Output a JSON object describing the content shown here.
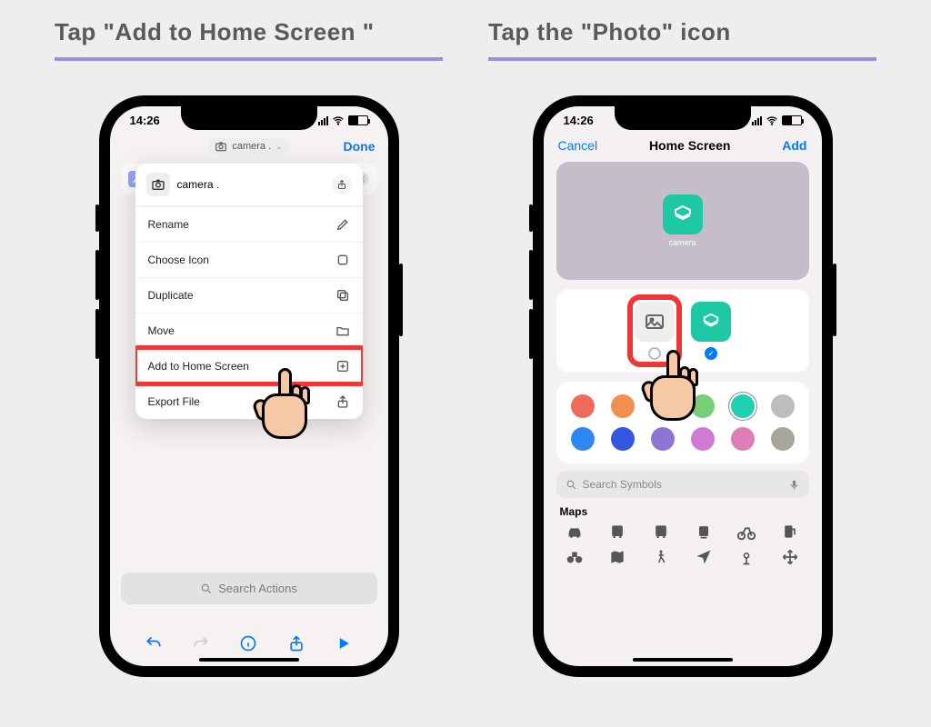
{
  "headings": {
    "left": "Tap \"Add to Home Screen \"",
    "right": "Tap the \"Photo\" icon"
  },
  "status": {
    "time": "14:26"
  },
  "left": {
    "title_pill": "camera .",
    "done": "Done",
    "menu_title": "camera .",
    "menu_items": [
      {
        "label": "Rename"
      },
      {
        "label": "Choose Icon"
      },
      {
        "label": "Duplicate"
      },
      {
        "label": "Move"
      },
      {
        "label": "Add to Home Screen"
      },
      {
        "label": "Export File"
      }
    ],
    "search_placeholder": "Search Actions"
  },
  "right": {
    "cancel": "Cancel",
    "title": "Home Screen",
    "add": "Add",
    "app_name": "camera",
    "search_symbols": "Search Symbols",
    "section": "Maps",
    "colors": [
      "#ef6a5a",
      "#f18f4d",
      "#e9c351",
      "#77cf78",
      "#1fcfb2",
      "#bdbdbd",
      "#2f87f1",
      "#3557e0",
      "#8f75d1",
      "#cf7bd4",
      "#dd7fb4",
      "#a7a59c"
    ]
  }
}
